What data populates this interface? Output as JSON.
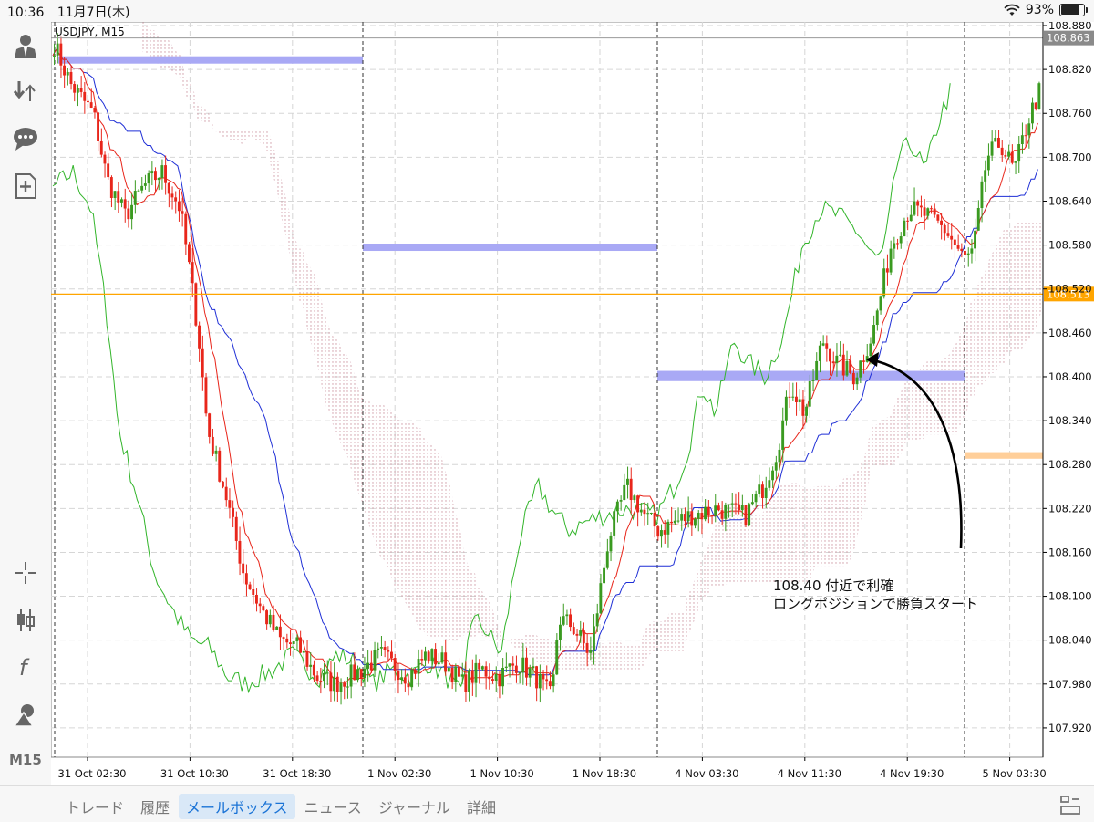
{
  "status_bar": {
    "time": "10:36",
    "date": "11月7日(木)",
    "battery": "93%",
    "battery_level": 0.93,
    "wifi_icon": "wifi-icon"
  },
  "sidebar": {
    "items": [
      {
        "name": "account",
        "icon": "user-icon"
      },
      {
        "name": "trade",
        "icon": "trade-arrows-icon"
      },
      {
        "name": "chat",
        "icon": "chat-icon"
      },
      {
        "name": "new-order",
        "icon": "new-document-icon"
      },
      {
        "name": "crosshair",
        "icon": "crosshair-icon"
      },
      {
        "name": "chart-type",
        "icon": "candlestick-icon"
      },
      {
        "name": "indicators",
        "icon": "function-icon"
      },
      {
        "name": "objects",
        "icon": "shapes-icon"
      }
    ],
    "timeframe": "M15"
  },
  "chart": {
    "symbol_label": "USDJPY, M15",
    "annotation_line1": "108.40 付近で利確",
    "annotation_line2": "ロングポジションで勝負スタート",
    "current_price": "108.863",
    "horizontal_line_price": "108.513",
    "colors": {
      "bull": "#3a9a20",
      "bear": "#e8261b",
      "tenkan": "#e8261b",
      "kijun": "#1f2fd6",
      "chikou": "#33b52b",
      "rect_blue": "#a9a9f5",
      "rect_orange": "#ffcf9a",
      "hline": "#ffa500"
    }
  },
  "chart_data": {
    "type": "candlestick",
    "symbol": "USDJPY",
    "timeframe": "M15",
    "y_ticks": [
      "108.880",
      "108.820",
      "108.760",
      "108.700",
      "108.640",
      "108.580",
      "108.520",
      "108.460",
      "108.400",
      "108.340",
      "108.280",
      "108.220",
      "108.160",
      "108.100",
      "108.040",
      "107.980",
      "107.920"
    ],
    "x_ticks": [
      "31 Oct 02:30",
      "31 Oct 10:30",
      "31 Oct 18:30",
      "1 Nov 02:30",
      "1 Nov 10:30",
      "1 Nov 18:30",
      "4 Nov 03:30",
      "4 Nov 11:30",
      "4 Nov 19:30",
      "5 Nov 03:30"
    ],
    "ylim": [
      107.88,
      108.885
    ],
    "current_price": 108.863,
    "horizontal_line": 108.513,
    "grid": true,
    "bid_line_color": "#999999"
  },
  "bottom_tabs": [
    {
      "label": "トレード",
      "active": false
    },
    {
      "label": "履歴",
      "active": false
    },
    {
      "label": "メールボックス",
      "active": true
    },
    {
      "label": "ニュース",
      "active": false
    },
    {
      "label": "ジャーナル",
      "active": false
    },
    {
      "label": "詳細",
      "active": false
    }
  ]
}
